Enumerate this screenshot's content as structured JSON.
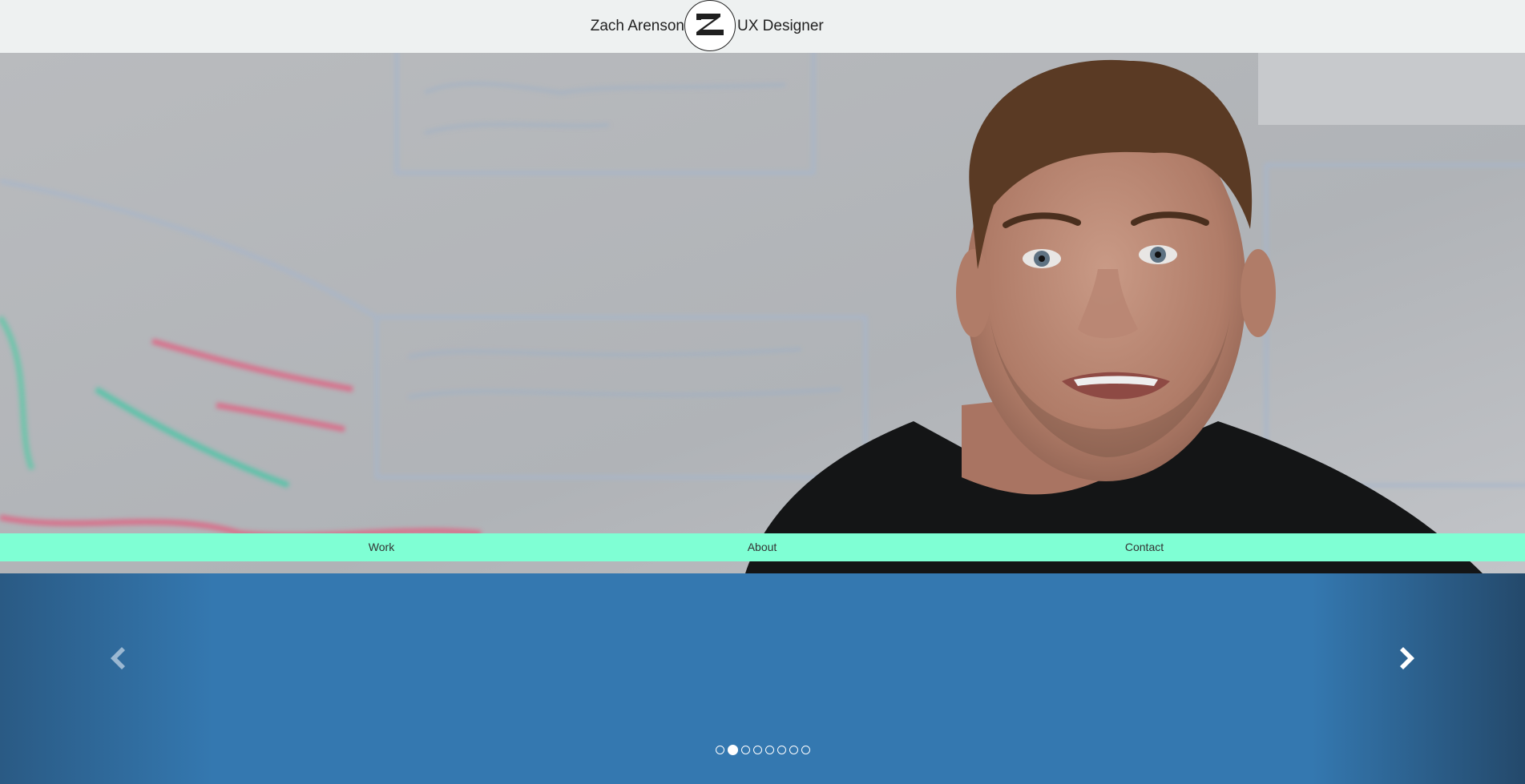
{
  "header": {
    "name": "Zach Arenson",
    "title": "UX Designer",
    "logo_icon": "za-monogram-logo"
  },
  "hero": {
    "image": "portrait-photo-whiteboard-background"
  },
  "nav": {
    "items": [
      {
        "label": "Work"
      },
      {
        "label": "About"
      },
      {
        "label": "Contact"
      }
    ],
    "background": "#7fffd4"
  },
  "carousel": {
    "prev_icon": "chevron-left-icon",
    "next_icon": "chevron-right-icon",
    "slide_count": 8,
    "active_index": 1,
    "background": "#3478b0"
  }
}
